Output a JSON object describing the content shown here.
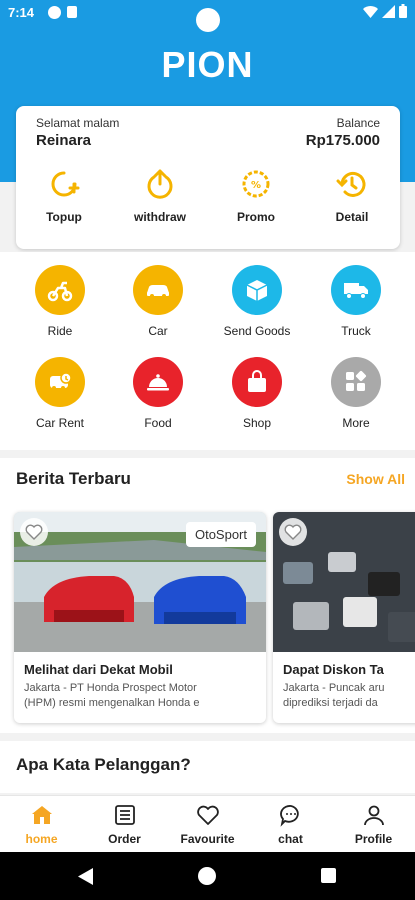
{
  "status_bar": {
    "time": "7:14"
  },
  "app": {
    "title": "PION"
  },
  "balance_card": {
    "greeting": "Selamat malam",
    "user_name": "Reinara",
    "balance_label": "Balance",
    "balance_value": "Rp175.000",
    "actions": [
      {
        "label": "Topup",
        "icon": "topup-icon"
      },
      {
        "label": "withdraw",
        "icon": "withdraw-icon"
      },
      {
        "label": "Promo",
        "icon": "promo-icon"
      },
      {
        "label": "Detail",
        "icon": "history-icon"
      }
    ]
  },
  "services": [
    {
      "label": "Ride",
      "icon": "motorbike-icon",
      "color": "#f5b400"
    },
    {
      "label": "Car",
      "icon": "car-icon",
      "color": "#f5b400"
    },
    {
      "label": "Send Goods",
      "icon": "package-icon",
      "color": "#1db8e8"
    },
    {
      "label": "Truck",
      "icon": "truck-icon",
      "color": "#1db8e8"
    },
    {
      "label": "Car Rent",
      "icon": "car-rent-icon",
      "color": "#f5b400"
    },
    {
      "label": "Food",
      "icon": "food-cloche-icon",
      "color": "#e8232b"
    },
    {
      "label": "Shop",
      "icon": "shopping-bag-icon",
      "color": "#e8232b"
    },
    {
      "label": "More",
      "icon": "more-grid-icon",
      "color": "#a9a9a9"
    }
  ],
  "news": {
    "title": "Berita Terbaru",
    "show_all": "Show All",
    "items": [
      {
        "tag": "OtoSport",
        "headline": "Melihat dari Dekat Mobil",
        "excerpt": "Jakarta - PT Honda Prospect Motor\n(HPM) resmi mengenalkan Honda e"
      },
      {
        "headline": "Dapat Diskon Ta",
        "excerpt": "Jakarta - Puncak aru\ndiprediksi terjadi da"
      }
    ]
  },
  "reviews": {
    "title": "Apa Kata Pelanggan?"
  },
  "bottom_nav": [
    {
      "label": "home",
      "icon": "home-icon",
      "active": true
    },
    {
      "label": "Order",
      "icon": "order-list-icon",
      "active": false
    },
    {
      "label": "Favourite",
      "icon": "heart-icon",
      "active": false
    },
    {
      "label": "chat",
      "icon": "chat-bubble-icon",
      "active": false
    },
    {
      "label": "Profile",
      "icon": "person-icon",
      "active": false
    }
  ],
  "colors": {
    "brand_blue": "#1a9be2",
    "accent_orange": "#f5a623"
  }
}
